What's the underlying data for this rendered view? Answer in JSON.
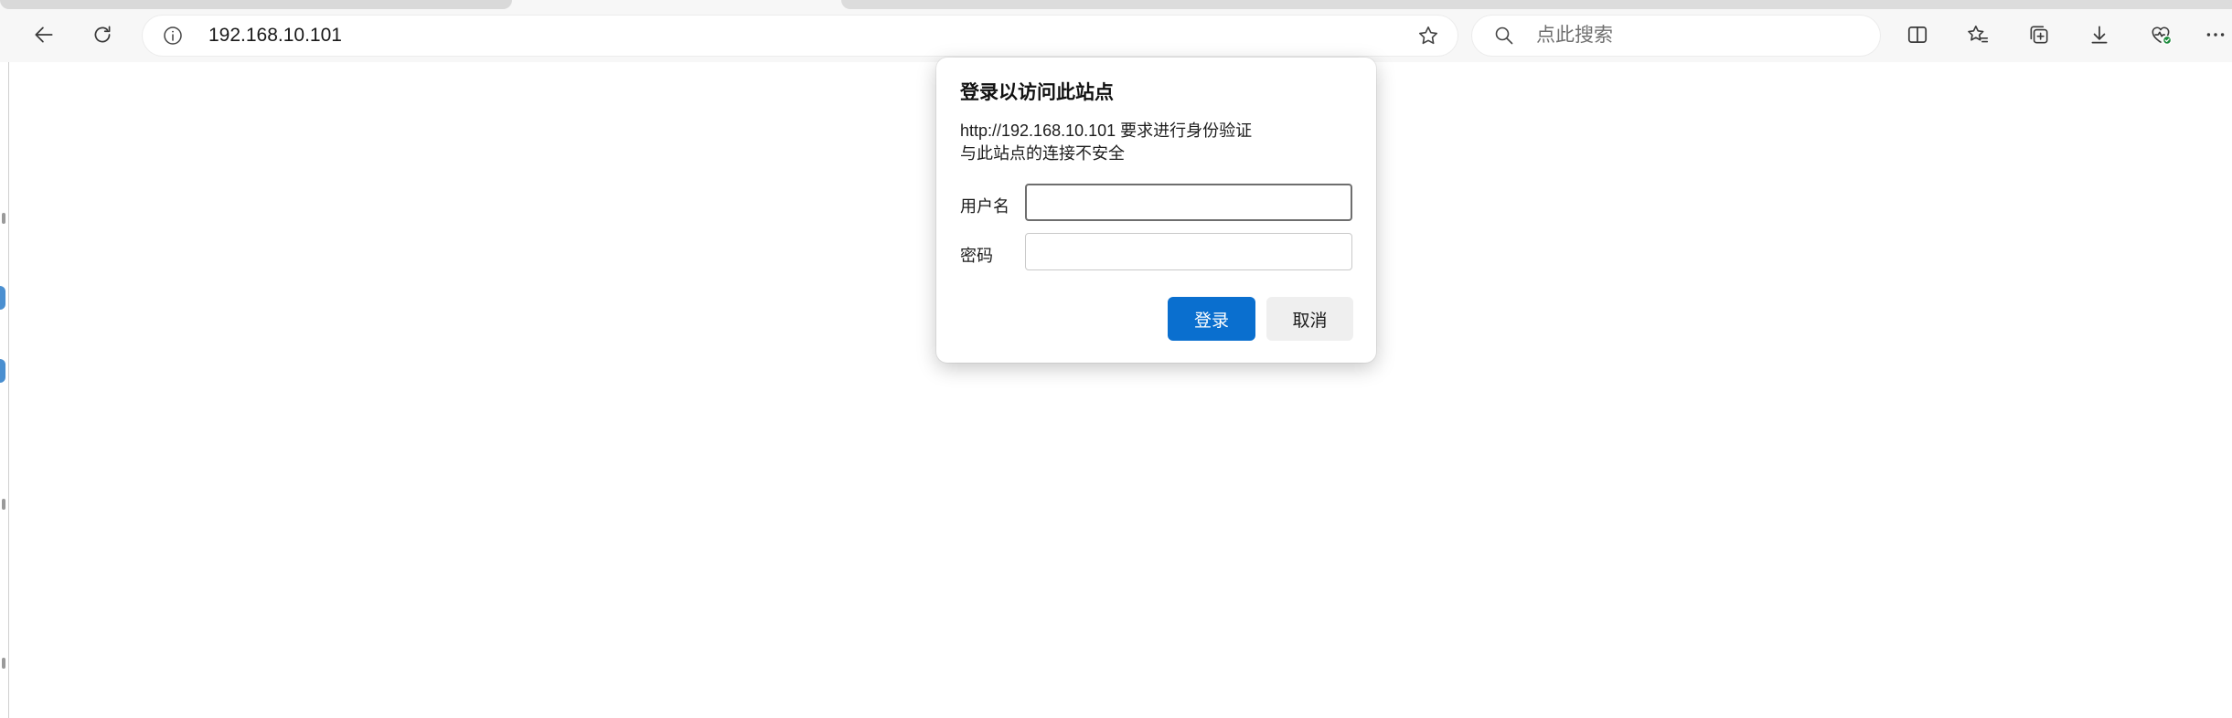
{
  "browser": {
    "address_bar": {
      "url": "192.168.10.101",
      "info_icon": "info-icon",
      "favorite_icon": "star-icon"
    },
    "search_bar": {
      "placeholder": "点此搜索",
      "icon": "search-icon"
    },
    "nav_icons": [
      "back-arrow-icon",
      "refresh-icon"
    ],
    "toolbar_icons": [
      "split-screen-icon",
      "favorites-icon",
      "collections-icon",
      "download-icon",
      "browser-essentials-icon",
      "more-icon"
    ]
  },
  "auth_dialog": {
    "title": "登录以访问此站点",
    "message_line1": "http://192.168.10.101 要求进行身份验证",
    "message_line2": "与此站点的连接不安全",
    "username_label": "用户名",
    "username_value": "",
    "password_label": "密码",
    "password_value": "",
    "login_label": "登录",
    "cancel_label": "取消"
  },
  "colors": {
    "primary_button": "#0a6fcf",
    "chrome_background": "#f7f7f7",
    "essentials_badge": "#1a8a3a"
  }
}
